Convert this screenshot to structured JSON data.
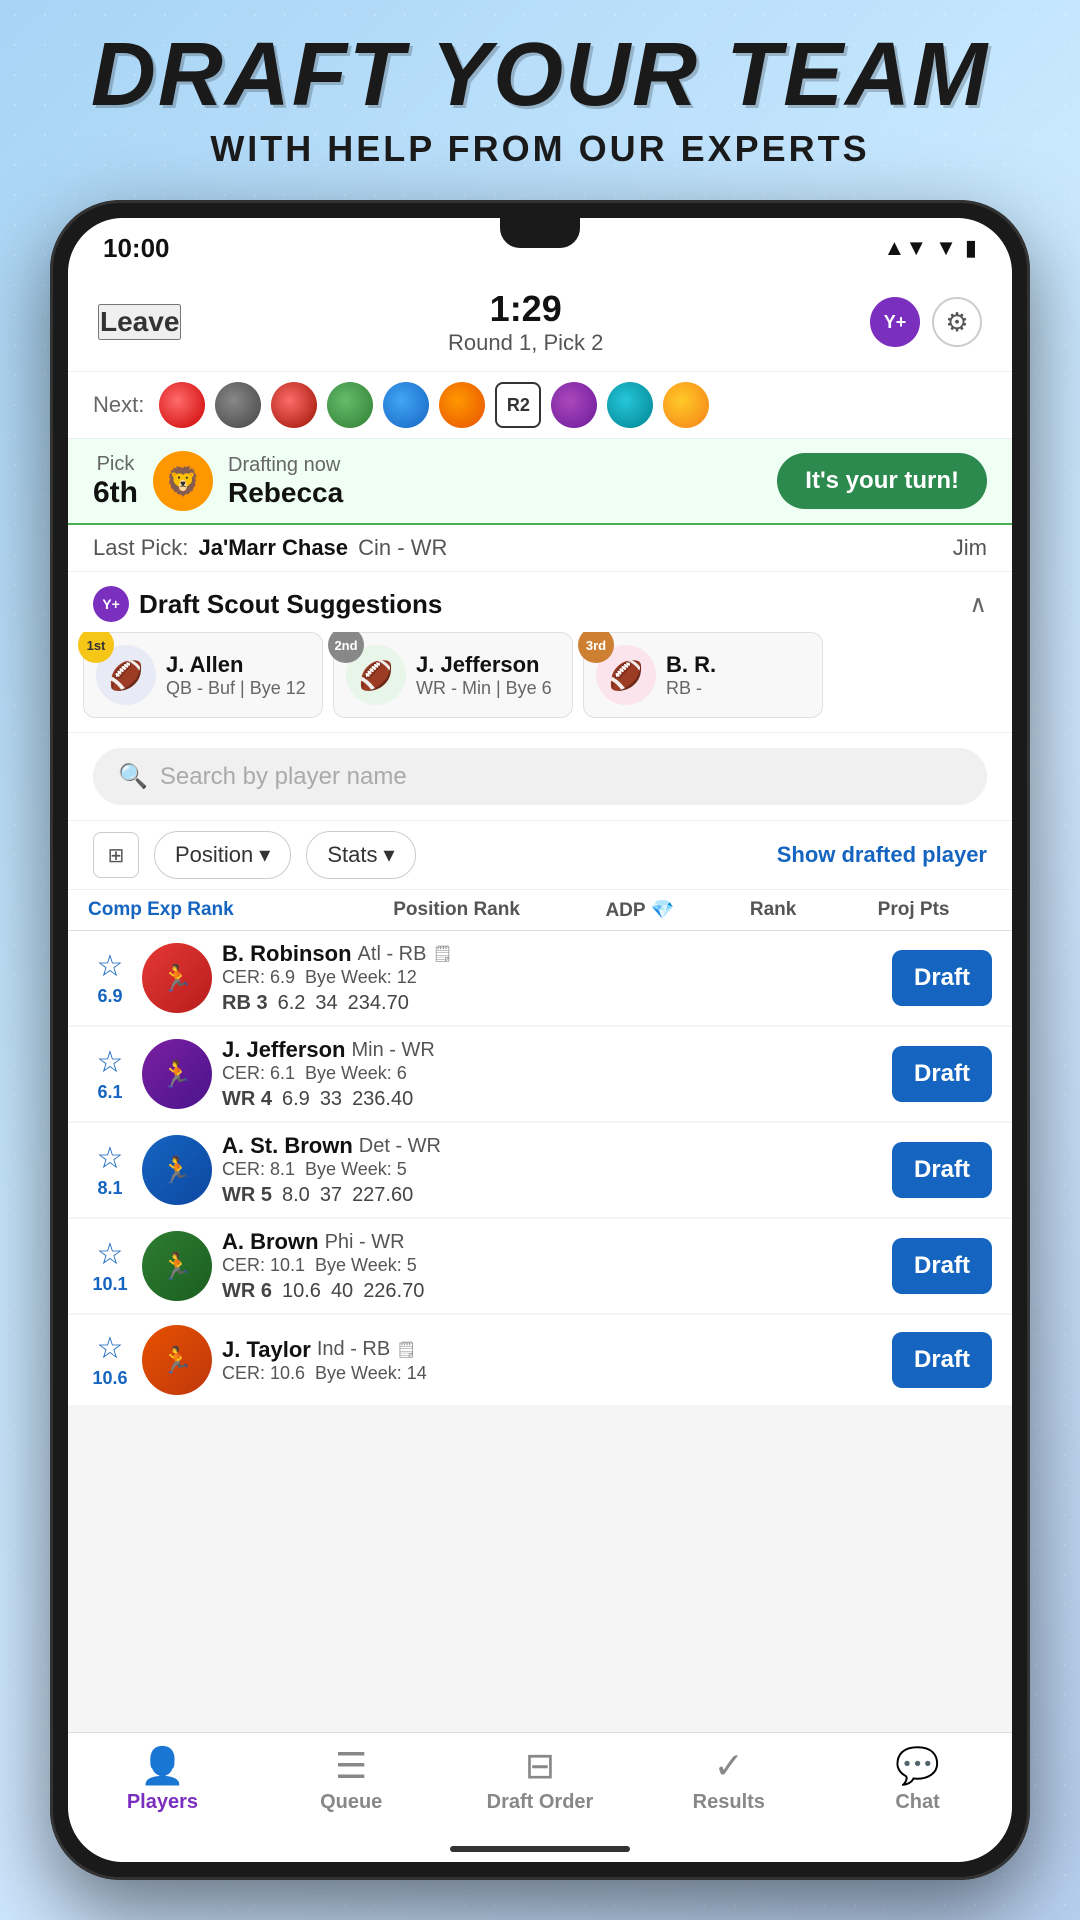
{
  "page": {
    "title": "DRAFT YOUR TEAM",
    "subtitle": "WITH HELP FROM OUR EXPERTS"
  },
  "status_bar": {
    "time": "10:00",
    "icons": [
      "▲",
      "▼",
      "🔋"
    ]
  },
  "app_header": {
    "leave_label": "Leave",
    "timer": "1:29",
    "round_pick": "Round 1, Pick 2",
    "yahoo_plus": "Y+",
    "gear": "⚙"
  },
  "draft_order": {
    "next_label": "Next:",
    "r2_label": "R2"
  },
  "drafting_now": {
    "pick_label": "Pick",
    "pick_num": "6th",
    "drafting_now_label": "Drafting now",
    "drafter_name": "Rebecca",
    "your_turn": "It's your turn!"
  },
  "last_pick": {
    "label": "Last Pick:",
    "player": "Ja'Marr Chase",
    "team_pos": "Cin - WR",
    "jim_label": "Jim"
  },
  "draft_scout": {
    "badge": "Y+",
    "title": "Draft Scout Suggestions",
    "chevron": "∧",
    "players": [
      {
        "rank": "1st",
        "name": "J. Allen",
        "pos": "QB - Buf | Bye 12",
        "avatar": "🏈"
      },
      {
        "rank": "2nd",
        "name": "J. Jefferson",
        "pos": "WR - Min | Bye 6",
        "avatar": "🏈"
      },
      {
        "rank": "3rd",
        "name": "B. R.",
        "pos": "RB -",
        "avatar": "🏈"
      }
    ]
  },
  "search": {
    "placeholder": "Search by player name",
    "icon": "🔍"
  },
  "filters": {
    "filter_icon": "⊞",
    "position_label": "Position",
    "stats_label": "Stats",
    "show_drafted": "Show drafted player"
  },
  "table_header": {
    "comp_exp": "Comp Exp Rank",
    "position_rank": "Position Rank",
    "adp": "ADP",
    "adp_icon": "💎",
    "rank": "Rank",
    "proj_pts": "Proj Pts"
  },
  "players": [
    {
      "cer": "6.9",
      "name": "B. Robinson",
      "team": "Atl - RB",
      "cer_label": "CER: 6.9",
      "bye": "Bye Week: 12",
      "pos_rank": "RB 3",
      "adp": "6.2",
      "rank": "34",
      "pts": "234.70",
      "avatar": "🏃"
    },
    {
      "cer": "6.1",
      "name": "J. Jefferson",
      "team": "Min - WR",
      "cer_label": "CER: 6.1",
      "bye": "Bye Week: 6",
      "pos_rank": "WR 4",
      "adp": "6.9",
      "rank": "33",
      "pts": "236.40",
      "avatar": "🏃"
    },
    {
      "cer": "8.1",
      "name": "A. St. Brown",
      "team": "Det - WR",
      "cer_label": "CER: 8.1",
      "bye": "Bye Week: 5",
      "pos_rank": "WR 5",
      "adp": "8.0",
      "rank": "37",
      "pts": "227.60",
      "avatar": "🏃"
    },
    {
      "cer": "10.1",
      "name": "A. Brown",
      "team": "Phi - WR",
      "cer_label": "CER: 10.1",
      "bye": "Bye Week: 5",
      "pos_rank": "WR 6",
      "adp": "10.6",
      "rank": "40",
      "pts": "226.70",
      "avatar": "🏃"
    },
    {
      "cer": "10.6",
      "name": "J. Taylor",
      "team": "Ind - RB",
      "cer_label": "CER: 10.6",
      "bye": "Bye Week: 14",
      "pos_rank": "",
      "adp": "",
      "rank": "",
      "pts": "",
      "avatar": "🏃"
    }
  ],
  "bottom_nav": {
    "items": [
      {
        "id": "players",
        "icon": "👤",
        "label": "Players",
        "active": true
      },
      {
        "id": "queue",
        "icon": "☰",
        "label": "Queue",
        "active": false
      },
      {
        "id": "draft-order",
        "icon": "⊟",
        "label": "Draft Order",
        "active": false
      },
      {
        "id": "results",
        "icon": "✓",
        "label": "Results",
        "active": false
      },
      {
        "id": "chat",
        "icon": "💬",
        "label": "Chat",
        "active": false
      }
    ]
  }
}
